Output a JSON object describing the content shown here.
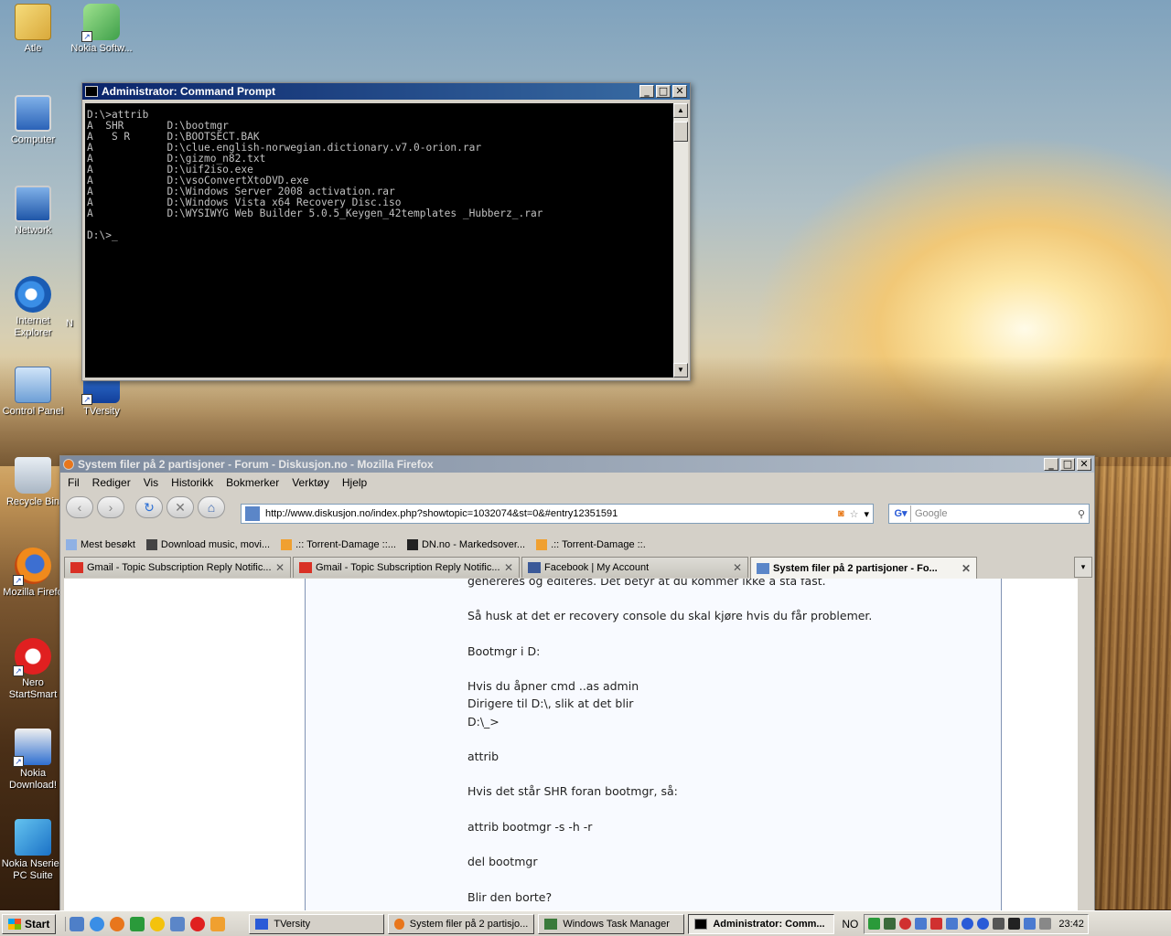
{
  "desktop": {
    "icons": [
      {
        "label": "Atle"
      },
      {
        "label": "Nokia Softw..."
      },
      {
        "label": "Computer"
      },
      {
        "label": "Network"
      },
      {
        "label": "Internet Explorer"
      },
      {
        "label": "N"
      },
      {
        "label": "Control Panel"
      },
      {
        "label": "TVersity"
      },
      {
        "label": "Recycle Bin"
      },
      {
        "label": "Mozilla Firefo"
      },
      {
        "label": "Nero StartSmart"
      },
      {
        "label": "Nokia Download!"
      },
      {
        "label": "Nokia Nseries PC Suite"
      }
    ]
  },
  "cmd": {
    "title": "Administrator: Command Prompt",
    "output": "D:\\>attrib\nA  SHR       D:\\bootmgr\nA   S R      D:\\BOOTSECT.BAK\nA            D:\\clue.english-norwegian.dictionary.v7.0-orion.rar\nA            D:\\gizmo_n82.txt\nA            D:\\uif2iso.exe\nA            D:\\vsoConvertXtoDVD.exe\nA            D:\\Windows Server 2008 activation.rar\nA            D:\\Windows Vista x64 Recovery Disc.iso\nA            D:\\WYSIWYG Web Builder 5.0.5_Keygen_42templates _Hubberz_.rar\n\nD:\\>_"
  },
  "firefox": {
    "title": "System filer på 2 partisjoner - Forum - Diskusjon.no - Mozilla Firefox",
    "menu": [
      "Fil",
      "Rediger",
      "Vis",
      "Historikk",
      "Bokmerker",
      "Verktøy",
      "Hjelp"
    ],
    "url": "http://www.diskusjon.no/index.php?showtopic=1032074&st=0&#entry12351591",
    "search_placeholder": "Google",
    "bookmarks": [
      "Mest besøkt",
      "Download music, movi...",
      ".:: Torrent-Damage ::...",
      "DN.no - Markedsover...",
      ".:: Torrent-Damage ::."
    ],
    "tabs": [
      {
        "label": "Gmail - Topic Subscription Reply Notific..."
      },
      {
        "label": "Gmail - Topic Subscription Reply Notific..."
      },
      {
        "label": "Facebook | My Account"
      },
      {
        "label": "System filer på 2 partisjoner - Fo..."
      }
    ],
    "post_text": "genereres og editeres. Det betyr at du kommer ikke å stå fast.\n\nSå husk at det er recovery console du skal kjøre hvis du får problemer.\n\nBootmgr i D:\n\nHvis du åpner cmd ..as admin\nDirigere til D:\\, slik at det blir\nD:\\_>\n\nattrib\n\nHvis det står SHR foran bootmgr, så:\n\nattrib bootmgr -s -h -r\n\ndel bootmgr\n\nBlir den borte?"
  },
  "taskbar": {
    "start": "Start",
    "tasks": [
      {
        "label": "TVersity"
      },
      {
        "label": "System filer på 2 partisjo..."
      },
      {
        "label": "Windows Task Manager"
      },
      {
        "label": "Administrator: Comm..."
      }
    ],
    "language": "NO",
    "clock": "23:42"
  }
}
